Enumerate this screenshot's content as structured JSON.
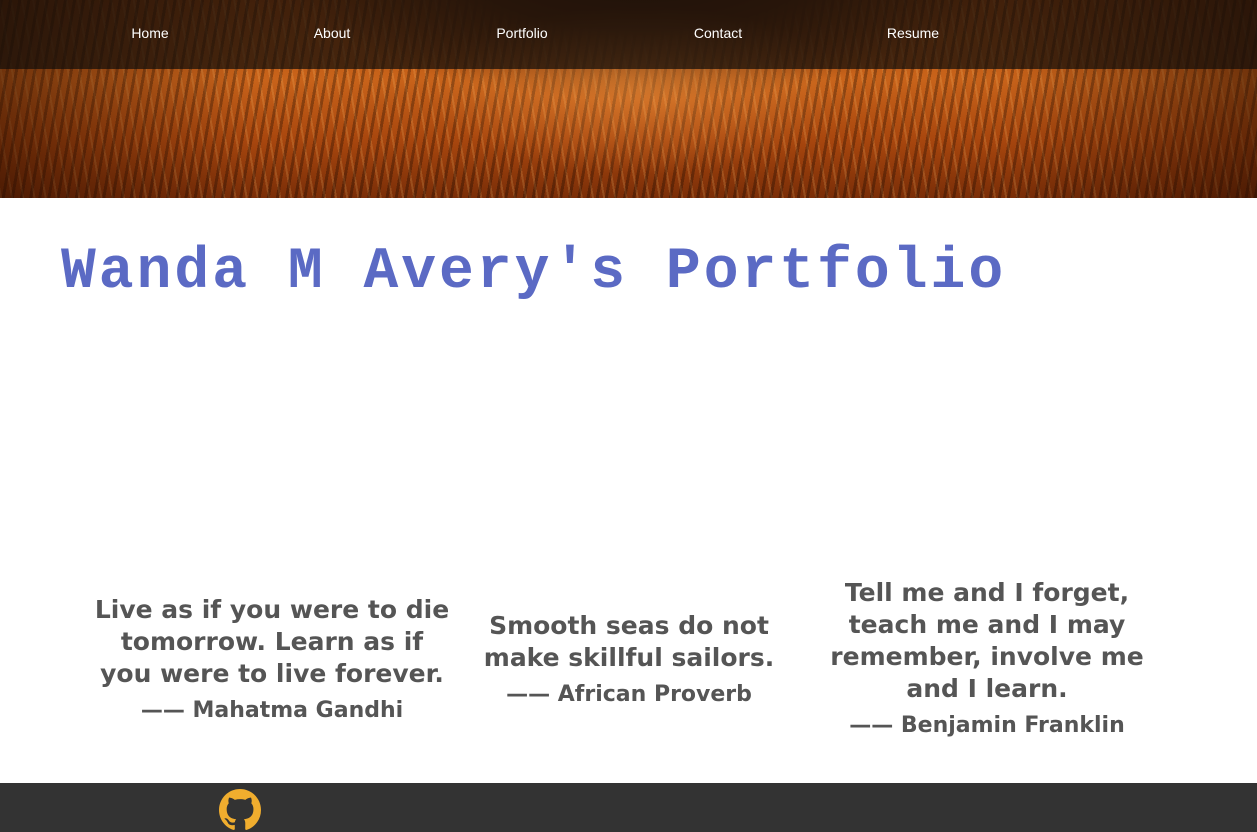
{
  "nav": {
    "items": [
      {
        "label": "Home"
      },
      {
        "label": "About"
      },
      {
        "label": "Portfolio"
      },
      {
        "label": "Contact"
      },
      {
        "label": "Resume"
      }
    ]
  },
  "title": "Wanda M Avery's Portfolio",
  "quotes": [
    {
      "text": "Live as if you were to die tomorrow. Learn as if you were to live forever.",
      "author": "—— Mahatma Gandhi"
    },
    {
      "text": "Smooth seas do not make skillful sailors.",
      "author": "—— African Proverb"
    },
    {
      "text": "Tell me and I forget, teach me and I may remember, involve me and I learn.",
      "author": "—— Benjamin Franklin"
    }
  ],
  "footer": {
    "icons": [
      "github-icon"
    ]
  },
  "colors": {
    "title": "#5b6ac4",
    "quote_text": "#555555",
    "footer_bg": "#333333",
    "github_icon": "#f0ad2e"
  }
}
